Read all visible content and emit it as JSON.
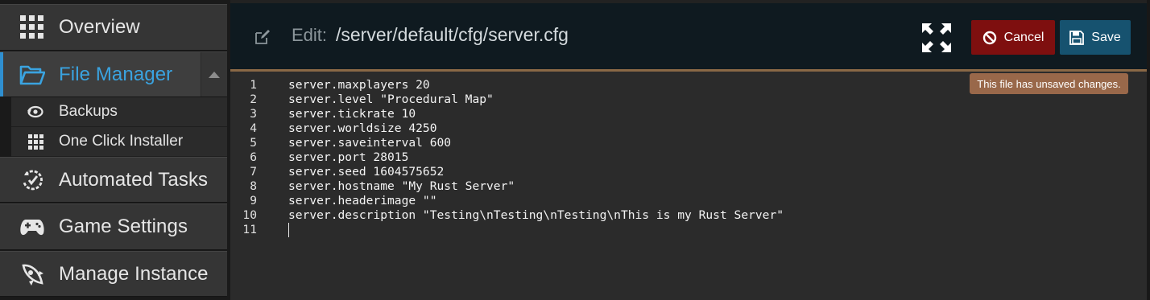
{
  "sidebar": {
    "items": [
      {
        "label": "Overview",
        "icon": "grid-icon"
      },
      {
        "label": "File Manager",
        "icon": "folder-open-icon"
      },
      {
        "label": "Automated Tasks",
        "icon": "task-clock-icon"
      },
      {
        "label": "Game Settings",
        "icon": "gamepad-icon"
      },
      {
        "label": "Manage Instance",
        "icon": "rocket-icon"
      }
    ],
    "sub_items": [
      {
        "label": "Backups",
        "icon": "backup-icon"
      },
      {
        "label": "One Click Installer",
        "icon": "grid-icon"
      }
    ],
    "active": "File Manager"
  },
  "header": {
    "edit_label": "Edit:",
    "path": "/server/default/cfg/server.cfg"
  },
  "toolbar": {
    "cancel_label": "Cancel",
    "save_label": "Save"
  },
  "tooltip": "This file has unsaved changes.",
  "editor": {
    "lines": [
      {
        "n": "1",
        "text": "server.maxplayers 20"
      },
      {
        "n": "2",
        "text": "server.level \"Procedural Map\""
      },
      {
        "n": "3",
        "text": "server.tickrate 10"
      },
      {
        "n": "4",
        "text": "server.worldsize 4250"
      },
      {
        "n": "5",
        "text": "server.saveinterval 600"
      },
      {
        "n": "6",
        "text": "server.port 28015"
      },
      {
        "n": "7",
        "text": "server.seed 1604575652"
      },
      {
        "n": "8",
        "text": "server.hostname \"My Rust Server\""
      },
      {
        "n": "9",
        "text": "server.headerimage \"\""
      },
      {
        "n": "10",
        "text": "server.description \"Testing\\nTesting\\nTesting\\nThis is my Rust Server\""
      },
      {
        "n": "11",
        "text": ""
      }
    ]
  },
  "colors": {
    "accent": "#2f8fd0",
    "cancel": "#7e0f0f",
    "save": "#16526f",
    "tooltip": "#99684a"
  }
}
